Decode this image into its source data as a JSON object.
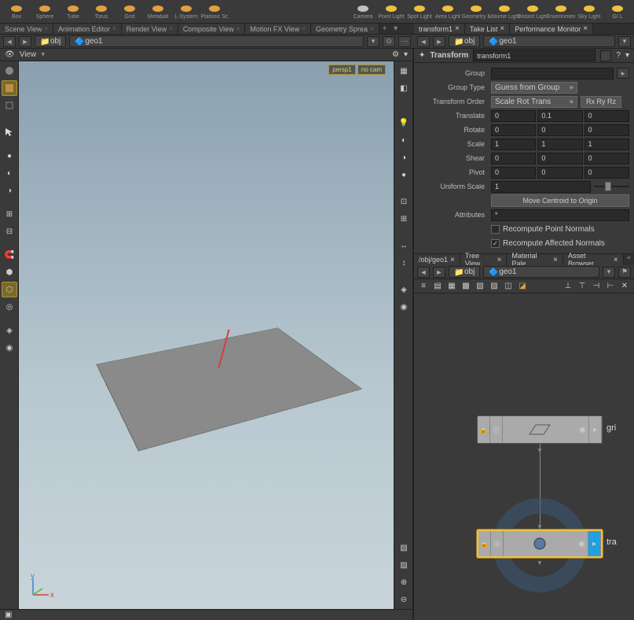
{
  "shelf_left": [
    {
      "name": "box",
      "label": "Box",
      "color": "#e0a040"
    },
    {
      "name": "sphere",
      "label": "Sphere",
      "color": "#e0a040"
    },
    {
      "name": "tube",
      "label": "Tube",
      "color": "#e0a040"
    },
    {
      "name": "torus",
      "label": "Torus",
      "color": "#e0a040"
    },
    {
      "name": "grid",
      "label": "Grid",
      "color": "#e0a040"
    },
    {
      "name": "metaball",
      "label": "Metaball",
      "color": "#e0a040"
    },
    {
      "name": "lsystem",
      "label": "L-System",
      "color": "#e0a040"
    },
    {
      "name": "platonic",
      "label": "Platonic Sc",
      "color": "#e0a040"
    }
  ],
  "shelf_right": [
    {
      "name": "camera",
      "label": "Camera",
      "color": "#c0c0c0"
    },
    {
      "name": "pointlight",
      "label": "Point Light",
      "color": "#f0c040"
    },
    {
      "name": "spotlight",
      "label": "Spot Light",
      "color": "#f0c040"
    },
    {
      "name": "arealight",
      "label": "Area Light",
      "color": "#f0c040"
    },
    {
      "name": "geolight",
      "label": "Geometry L",
      "color": "#f0c040"
    },
    {
      "name": "vollight",
      "label": "Volume Light",
      "color": "#f0c040"
    },
    {
      "name": "distlight",
      "label": "Distant Light",
      "color": "#f0c040"
    },
    {
      "name": "envlight",
      "label": "Environmen",
      "color": "#f0c040"
    },
    {
      "name": "skylight",
      "label": "Sky Light",
      "color": "#f0c040"
    },
    {
      "name": "gilight",
      "label": "GI L",
      "color": "#f0c040"
    }
  ],
  "left_tabs": [
    "Scene View",
    "Animation Editor",
    "Render View",
    "Composite View",
    "Motion FX View",
    "Geometry Sprea"
  ],
  "left_path": {
    "seg1": "obj",
    "seg2": "geo1"
  },
  "view_label": "View",
  "vp_badges": [
    "persp1",
    "no cam"
  ],
  "right_top_tabs": [
    "transform1",
    "Take List",
    "Performance Monitor"
  ],
  "right_path": {
    "seg1": "obj",
    "seg2": "geo1"
  },
  "param_header": {
    "type": "Transform",
    "name": "transform1"
  },
  "params": {
    "group_lbl": "Group",
    "group_val": "",
    "gtype_lbl": "Group Type",
    "gtype_val": "Guess from Group",
    "torder_lbl": "Transform Order",
    "torder_val": "Scale Rot Trans",
    "torder_btn": "Rx Ry Rz",
    "translate_lbl": "Translate",
    "translate": [
      "0",
      "0.1",
      "0"
    ],
    "rotate_lbl": "Rotate",
    "rotate": [
      "0",
      "0",
      "0"
    ],
    "scale_lbl": "Scale",
    "scale": [
      "1",
      "1",
      "1"
    ],
    "shear_lbl": "Shear",
    "shear": [
      "0",
      "0",
      "0"
    ],
    "pivot_lbl": "Pivot",
    "pivot": [
      "0",
      "0",
      "0"
    ],
    "uscale_lbl": "Uniform Scale",
    "uscale": "1",
    "centroid_btn": "Move Centroid to Origin",
    "attrs_lbl": "Attributes",
    "attrs_val": "*",
    "recomp_pt": "Recompute Point Normals",
    "recomp_aff": "Recompute Affected Normals"
  },
  "net_tabs": [
    "/obj/geo1",
    "Tree View",
    "Material Pale",
    "Asset Browser"
  ],
  "net_path": {
    "seg1": "obj",
    "seg2": "geo1"
  },
  "nodes": {
    "grid": {
      "label": "gri"
    },
    "transform": {
      "label": "tra"
    }
  }
}
